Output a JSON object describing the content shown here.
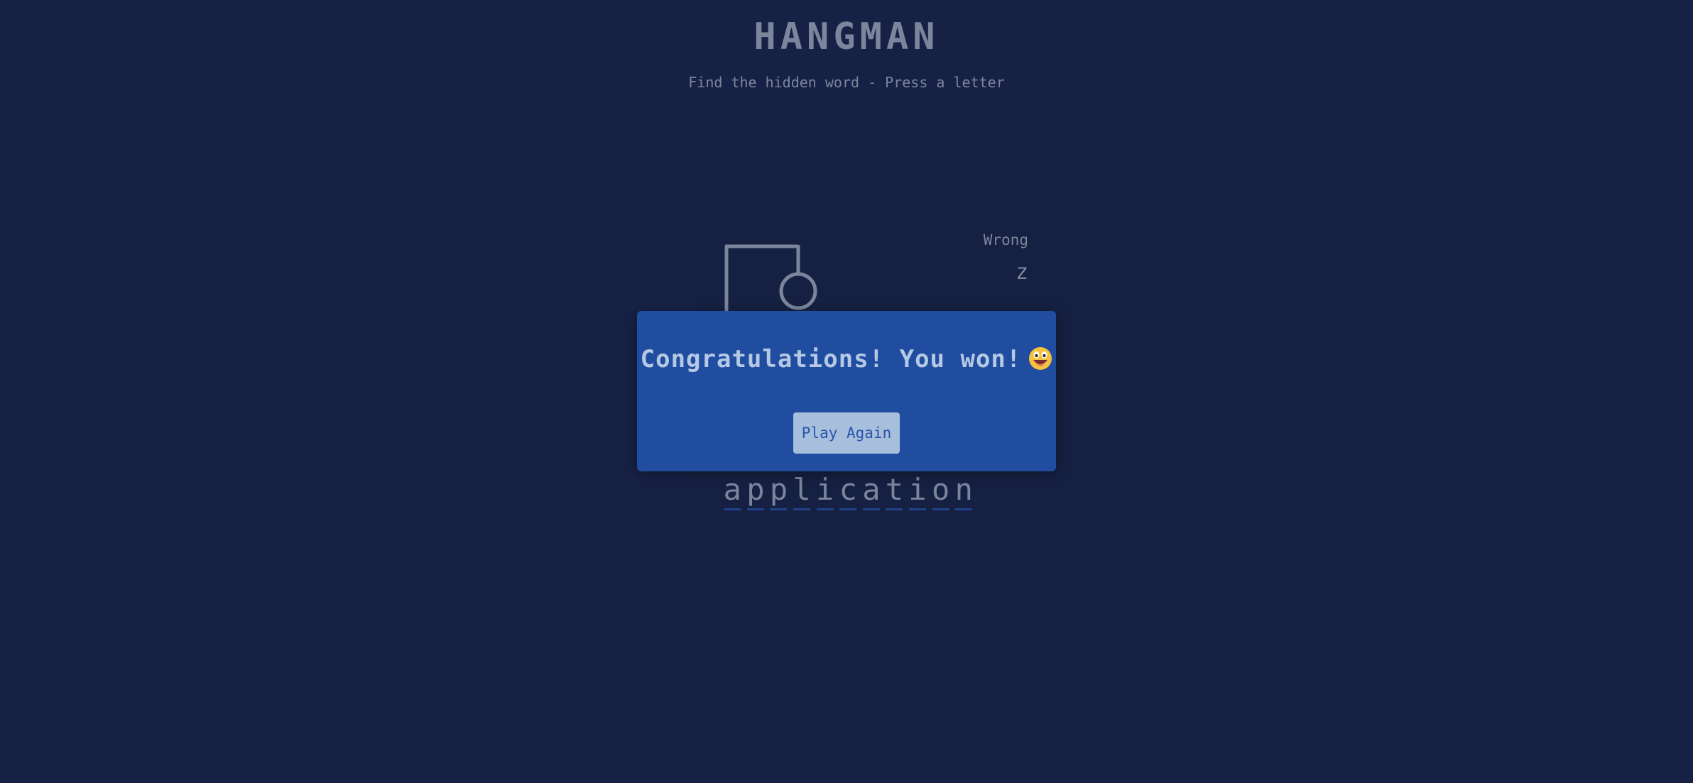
{
  "header": {
    "title": "HANGMAN",
    "subtitle": "Find the hidden word - Press a letter"
  },
  "wrong": {
    "label": "Wrong",
    "letters": "z"
  },
  "word": {
    "letters": [
      "a",
      "p",
      "p",
      "l",
      "i",
      "c",
      "a",
      "t",
      "i",
      "o",
      "n"
    ]
  },
  "modal": {
    "message": "Congratulations! You won!",
    "emoji_icon": "grinning-face-icon",
    "button_label": "Play Again"
  },
  "hangman": {
    "wrong_count": 1
  },
  "colors": {
    "background": "#172145",
    "modal": "#214da0",
    "button": "#a7bfdc",
    "text_muted": "#7b869c",
    "underline": "#21428a"
  }
}
